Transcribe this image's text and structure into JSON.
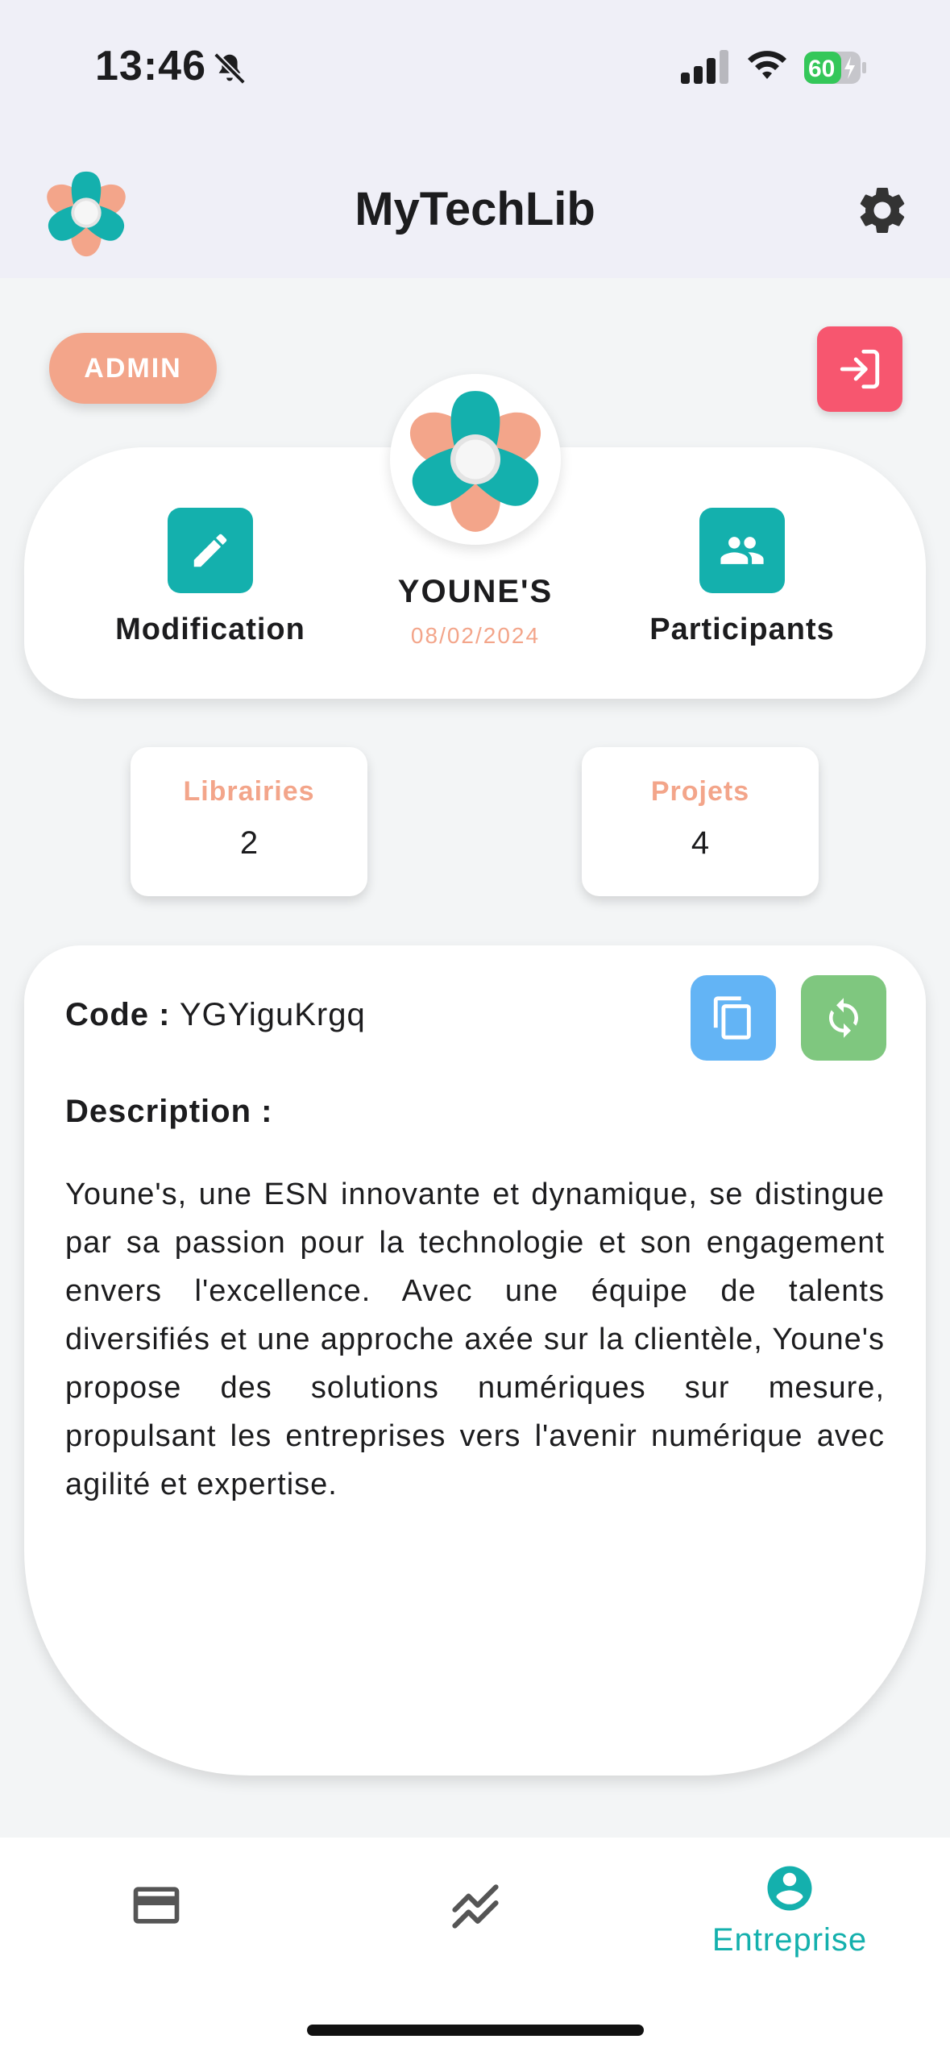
{
  "status_bar": {
    "time": "13:46",
    "battery": "60"
  },
  "header": {
    "title": "MyTechLib"
  },
  "role_badge": "ADMIN",
  "company": {
    "name": "YOUNE'S",
    "date": "08/02/2024"
  },
  "actions": {
    "edit_label": "Modification",
    "participants_label": "Participants"
  },
  "stats": [
    {
      "label": "Librairies",
      "value": "2"
    },
    {
      "label": "Projets",
      "value": "4"
    }
  ],
  "info": {
    "code_label": "Code :",
    "code_value": "YGYiguKrgq",
    "description_label": "Description :",
    "description": "Youne's, une ESN innovante et dynamique, se distingue par sa passion pour la technologie et son engagement envers l'excellence. Avec une équipe de talents diversifiés et une approche axée sur la clientèle, Youne's propose des solutions numériques sur mesure, propulsant les entreprises vers l'avenir numérique avec agilité et expertise."
  },
  "bottom_nav": {
    "active_label": "Entreprise"
  },
  "colors": {
    "accent": "#14b0ad",
    "peach": "#f3a58a",
    "danger": "#f7566f",
    "copy": "#63b4f5",
    "refresh": "#7fc77f"
  }
}
